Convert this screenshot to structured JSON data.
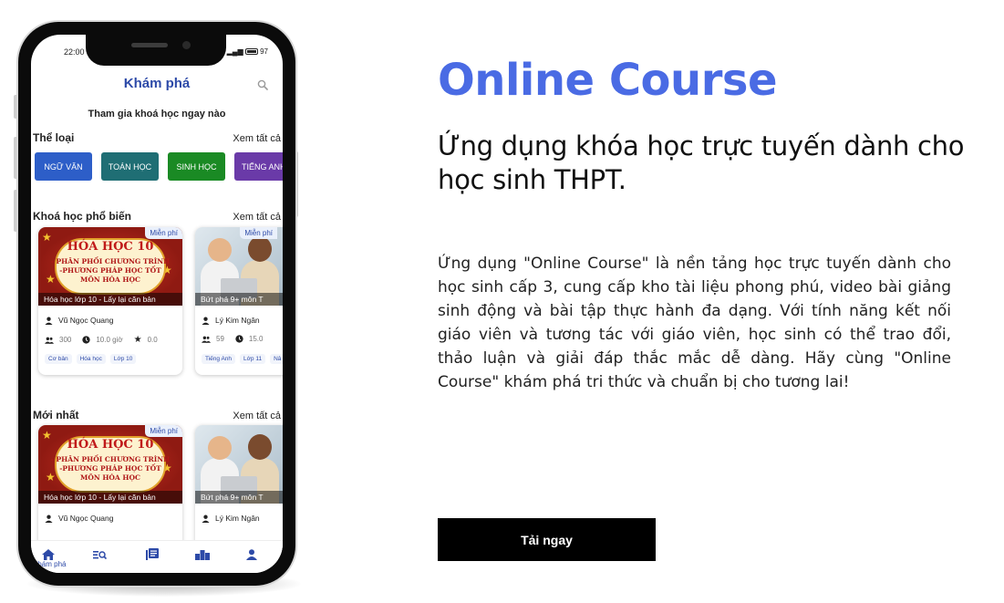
{
  "phone": {
    "status": {
      "time": "22:00",
      "battery": "97"
    },
    "app_title": "Khám phá",
    "welcome": "Tham gia khoá học ngay nào",
    "categories_section": {
      "title": "Thể loại",
      "see_all": "Xem tất cả",
      "items": [
        {
          "label": "NGỮ VĂN",
          "color": "#2d5ec8"
        },
        {
          "label": "TOÁN HỌC",
          "color": "#1f6e74"
        },
        {
          "label": "SINH HỌC",
          "color": "#1a8a24"
        },
        {
          "label": "TIẾNG ANH",
          "color": "#6a3aa8"
        }
      ]
    },
    "popular_section": {
      "title": "Khoá học phổ biến",
      "see_all": "Xem tất cả"
    },
    "newest_section": {
      "title": "Mới nhất",
      "see_all": "Xem tất cả"
    },
    "courses": [
      {
        "badge": "Miễn phí",
        "thumb_title": "HÓA HỌC 10",
        "thumb_line1": "- PHÂN PHỐI CHƯƠNG TRÌNH",
        "thumb_line2": "-PHƯƠNG PHÁP HỌC TỐT",
        "thumb_line3": "MÔN HÓA HỌC",
        "caption": "Hóa học lớp 10 - Lấy lại căn bản",
        "teacher": "Vũ Ngọc Quang",
        "students": "300",
        "hours": "10.0 giờ",
        "rating": "0.0",
        "tags": [
          "Cơ bản",
          "Hóa học",
          "Lớp 10"
        ]
      },
      {
        "badge": "Miễn phí",
        "caption": "Bứt phá 9+ môn T",
        "teacher": "Lý Kim Ngân",
        "students": "59",
        "hours": "15.0",
        "tags": [
          "Tiếng Anh",
          "Lớp 11",
          "Nâ"
        ]
      }
    ],
    "nav": {
      "home_label": "Khám phá"
    }
  },
  "hero": {
    "title": "Online Course",
    "subtitle": "Ứng dụng khóa học trực tuyến dành cho học sinh THPT.",
    "description": "Ứng dụng \"Online Course\" là nền tảng học trực tuyến dành cho học sinh cấp 3, cung cấp kho tài liệu phong phú, video bài giảng sinh động và bài tập thực hành đa dạng. Với tính năng kết nối giáo viên và tương tác với giáo viên, học sinh có thể trao đổi, thảo luận và giải đáp thắc mắc dễ dàng. Hãy cùng \"Online Course\" khám phá tri thức và chuẩn bị cho tương lai!",
    "cta": "Tải ngay"
  },
  "colors": {
    "accent": "#4a6be4",
    "app_blue": "#2d4aa8",
    "cta_bg": "#000000"
  }
}
